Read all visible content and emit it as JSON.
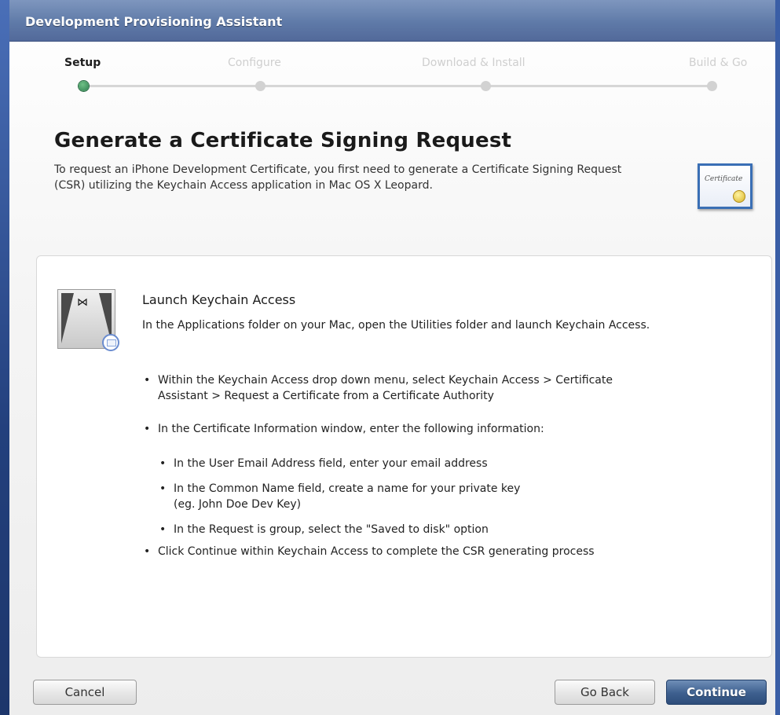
{
  "window": {
    "title": "Development Provisioning Assistant"
  },
  "steps": [
    {
      "label": "Setup",
      "active": true
    },
    {
      "label": "Configure",
      "active": false
    },
    {
      "label": "Download & Install",
      "active": false
    },
    {
      "label": "Build & Go",
      "active": false
    }
  ],
  "header": {
    "title": "Generate a Certificate Signing Request",
    "description": "To request an iPhone Development Certificate, you first need to generate a Certificate Signing Request (CSR) utilizing the Keychain Access application in Mac OS X Leopard.",
    "icon": "certificate-icon",
    "icon_text": "Certificate"
  },
  "panel": {
    "icon": "keychain-access-icon",
    "title": "Launch Keychain Access",
    "description": "In the Applications folder on your Mac, open the Utilities folder and launch Keychain Access.",
    "bullets": [
      {
        "line1": "Within the Keychain Access drop down menu, select Keychain Access > Certificate",
        "line2": "Assistant > Request a Certificate from a Certificate Authority"
      },
      {
        "line1": "In the Certificate Information window, enter the following information:"
      },
      {
        "line1": "In the User Email Address field, enter your email address"
      },
      {
        "line1": "In the Common Name field, create a name for your private key",
        "line2": "(eg. John Doe Dev Key)"
      },
      {
        "line1": "In the Request is group, select the \"Saved to disk\" option"
      },
      {
        "line1": "Click Continue within Keychain Access to complete the CSR generating process"
      }
    ]
  },
  "buttons": {
    "cancel": "Cancel",
    "go_back": "Go Back",
    "continue": "Continue"
  },
  "colors": {
    "accent": "#3d5f8e",
    "step_active": "#2f8050",
    "titlebar": "#5f7aa8"
  }
}
